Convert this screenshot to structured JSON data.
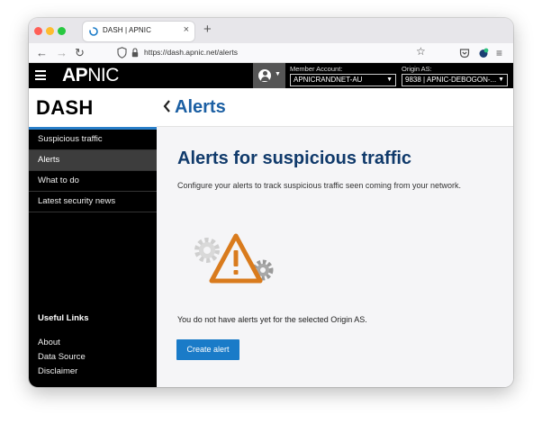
{
  "browser": {
    "tab_title": "DASH | APNIC",
    "tab_close": "×",
    "new_tab": "+",
    "back": "←",
    "forward": "→",
    "reload": "↻",
    "url": "https://dash.apnic.net/alerts",
    "bookmark": "☆",
    "menu": "≡"
  },
  "header": {
    "logo_bold": "AP",
    "logo_regular": "NIC",
    "member_account_label": "Member Account:",
    "member_account_value": "APNICRANDNET-AU",
    "origin_as_label": "Origin AS:",
    "origin_as_value": "9838 | APNIC-DEBOGON-...",
    "select_arrow": "▼",
    "account_caret": "▼"
  },
  "sidebar": {
    "title": "DASH",
    "items": [
      {
        "label": "Suspicious traffic",
        "active": false
      },
      {
        "label": "Alerts",
        "active": true
      },
      {
        "label": "What to do",
        "active": false
      },
      {
        "label": "Latest security news",
        "active": false
      }
    ],
    "useful_links_title": "Useful Links",
    "useful_links": [
      "About",
      "Data Source",
      "Disclaimer"
    ]
  },
  "main": {
    "page_title": "Alerts",
    "heading": "Alerts for suspicious traffic",
    "description": "Configure your alerts to track suspicious traffic seen coming from your network.",
    "empty_message": "You do not have alerts yet for the selected Origin AS.",
    "create_button": "Create alert"
  },
  "colors": {
    "brand_blue": "#1b5fa3",
    "heading_navy": "#103a6b",
    "button_blue": "#1a7bc8",
    "warning_orange": "#d97b1d",
    "sidebar_bg": "#000000"
  }
}
